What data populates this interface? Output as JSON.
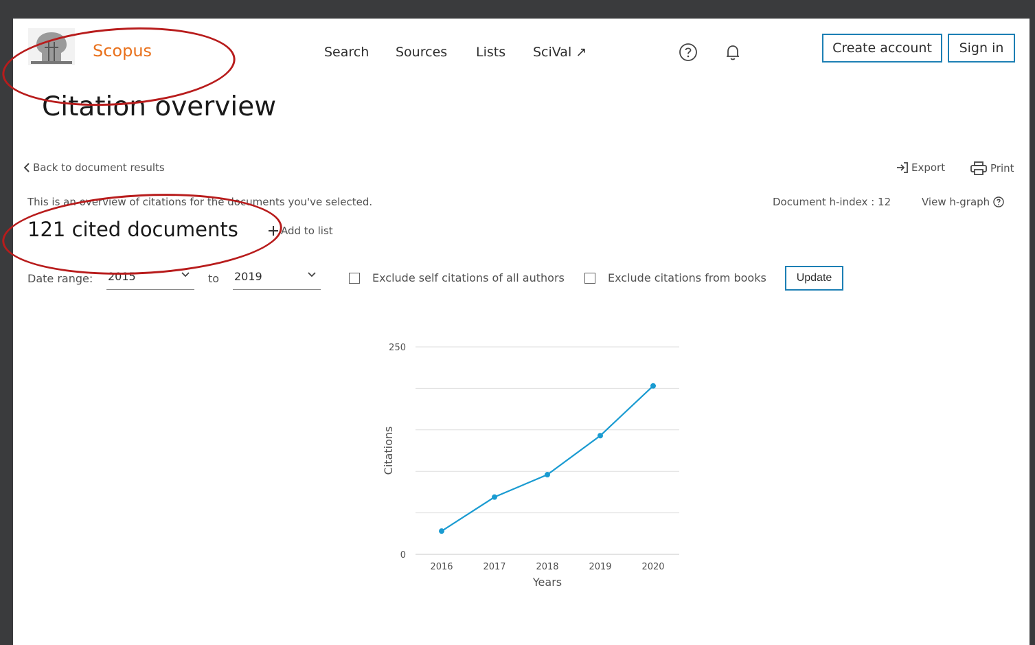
{
  "header": {
    "brand": "Scopus",
    "nav": [
      "Search",
      "Sources",
      "Lists",
      "SciVal ↗"
    ],
    "help_icon": "help-circle-icon",
    "notification_icon": "bell-icon",
    "create_account": "Create account",
    "sign_in": "Sign in"
  },
  "page": {
    "title": "Citation overview",
    "back_link": "Back to document results",
    "export": "Export",
    "print": "Print",
    "description": "This is an overview of citations for the documents you've selected.",
    "h_index_label": "Document h-index : 12",
    "view_h_graph": "View h-graph",
    "cited_count": "121 cited documents",
    "add_to_list": "Add to list"
  },
  "filters": {
    "date_range_label": "Date range:",
    "from": "2015",
    "to_label": "to",
    "to": "2019",
    "exclude_self": "Exclude self citations of all authors",
    "exclude_books": "Exclude citations from books",
    "update": "Update"
  },
  "colors": {
    "brand": "#e9711c",
    "accent": "#1c7fb4",
    "line": "#1a9bd1",
    "annotation": "#b81c1c"
  },
  "chart_data": {
    "type": "line",
    "x": [
      "2016",
      "2017",
      "2018",
      "2019",
      "2020"
    ],
    "series": [
      {
        "values": [
          28,
          69,
          96,
          143,
          203
        ]
      }
    ],
    "xlabel": "Years",
    "ylabel": "Citations",
    "ylim": [
      0,
      250
    ],
    "yticks_labeled": [
      "0",
      "250"
    ],
    "grid": true,
    "legend": "none"
  }
}
